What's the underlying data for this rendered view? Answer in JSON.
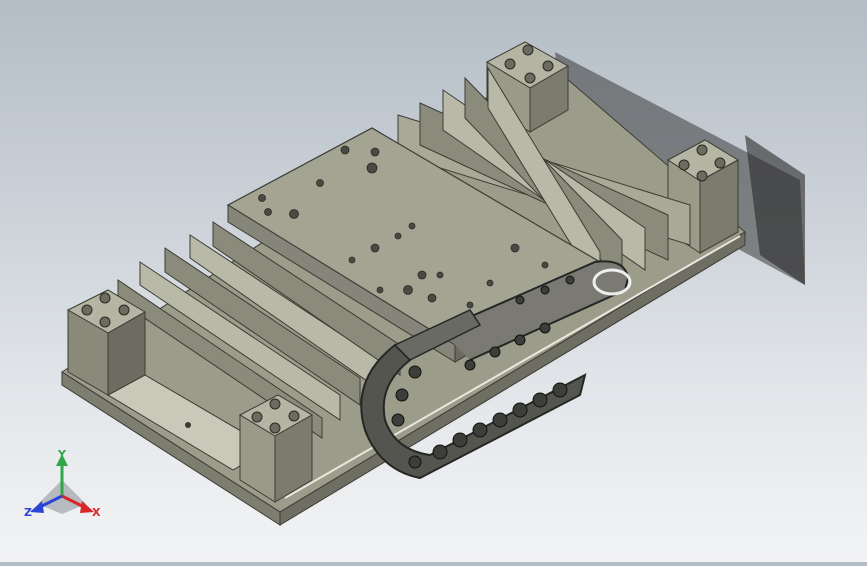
{
  "viewport": {
    "background_top": "#b4bdc6",
    "background_bottom": "#f2f3f4",
    "model_color": "#a8a896",
    "model_shadow_color": "#53534a",
    "cable_chain_color": "#2f2f2f"
  },
  "triad": {
    "x_label": "X",
    "y_label": "Y",
    "z_label": "Z",
    "x_color": "#d8262a",
    "y_color": "#2fa84a",
    "z_color": "#2b43d6"
  }
}
